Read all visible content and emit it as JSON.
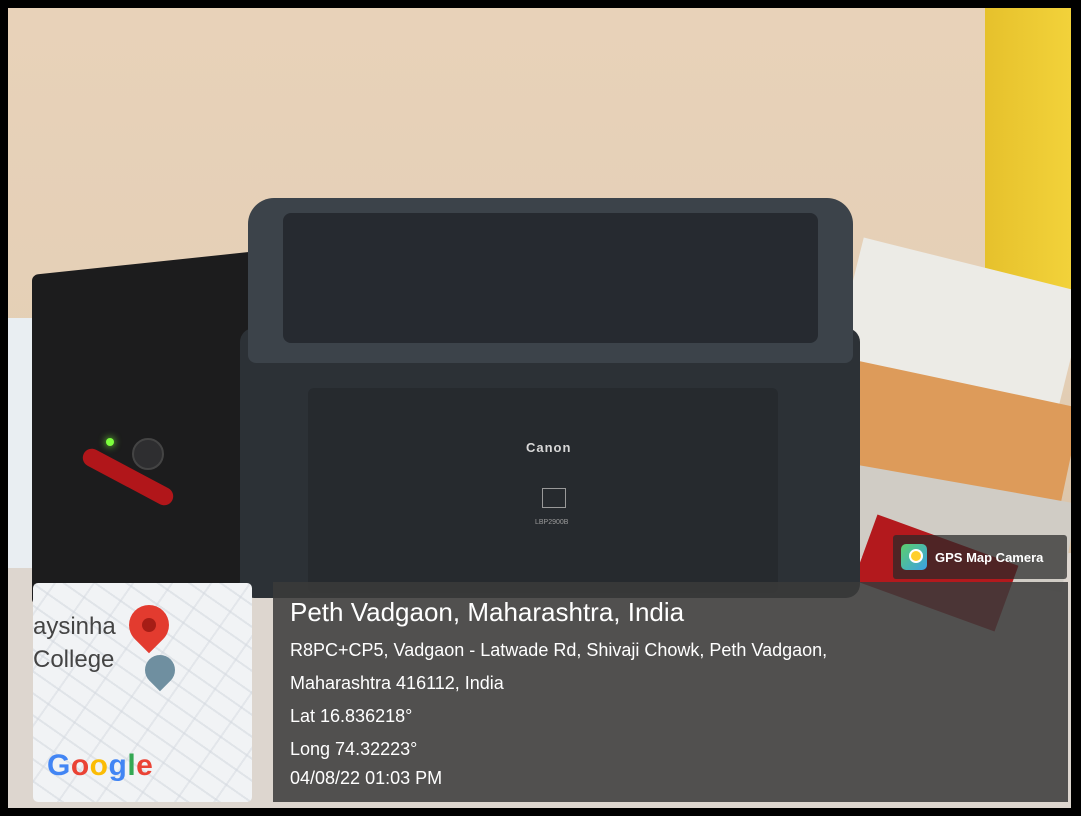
{
  "photo": {
    "printer_brand": "Canon",
    "printer_model": "LBP2900B"
  },
  "badge": {
    "label": "GPS Map Camera",
    "icon": "gps-map-camera-icon"
  },
  "map": {
    "label_line1": "aysinha",
    "label_line2": "College",
    "pin_icon": "map-pin-icon",
    "school_icon": "school-pin-icon",
    "logo_text": "Google"
  },
  "info": {
    "title": "Peth Vadgaon, Maharashtra, India",
    "address_line1": "R8PC+CP5, Vadgaon - Latwade Rd, Shivaji Chowk, Peth Vadgaon,",
    "address_line2": "Maharashtra 416112, India",
    "lat": "Lat 16.836218°",
    "long": "Long 74.32223°",
    "datetime": "04/08/22 01:03 PM"
  }
}
